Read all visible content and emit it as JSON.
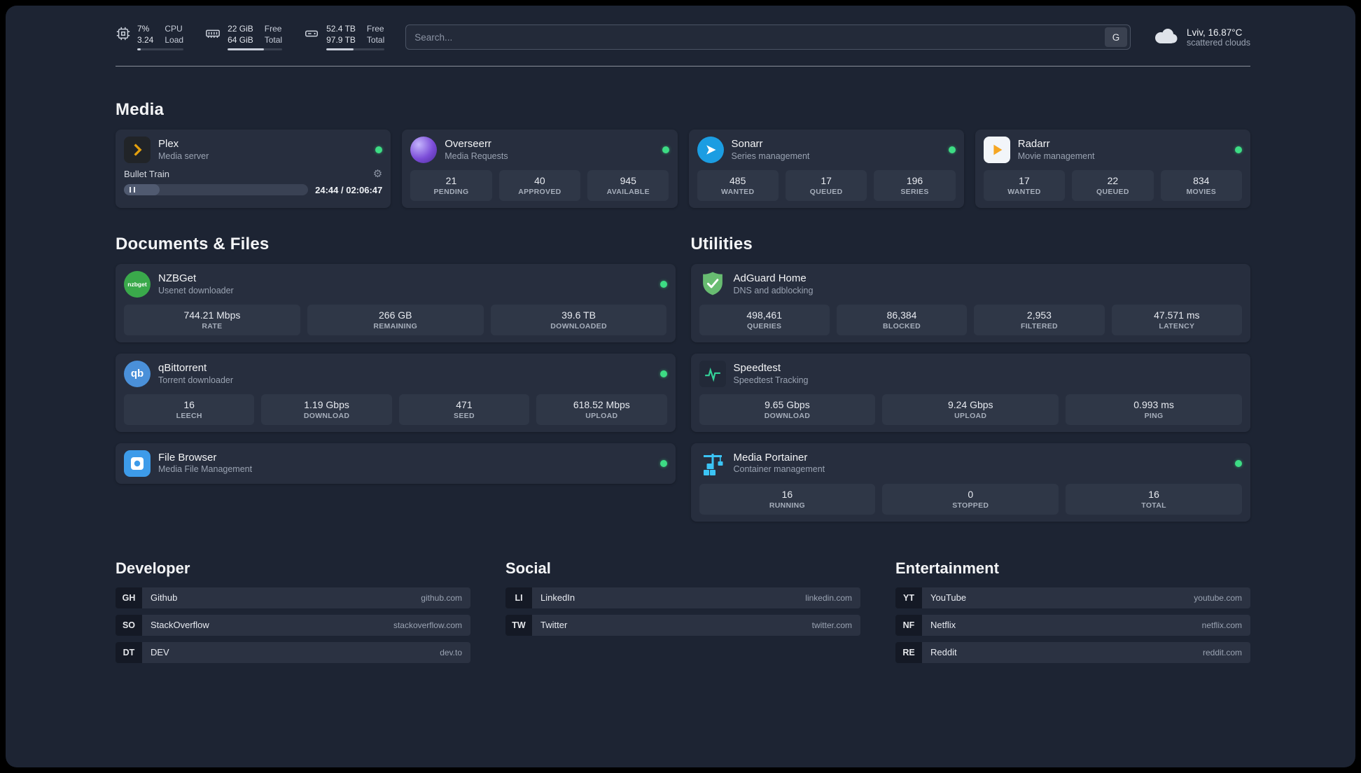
{
  "topbar": {
    "cpu": {
      "v1": "7%",
      "v2": "3.24",
      "l1": "CPU",
      "l2": "Load",
      "bar_pct": 7
    },
    "mem": {
      "v1": "22 GiB",
      "v2": "64 GiB",
      "l1": "Free",
      "l2": "Total",
      "bar_pct": 66
    },
    "disk": {
      "v1": "52.4 TB",
      "v2": "97.9 TB",
      "l1": "Free",
      "l2": "Total",
      "bar_pct": 47
    },
    "search": {
      "placeholder": "Search...",
      "button": "G"
    },
    "weather": {
      "location": "Lviv, 16.87°C",
      "condition": "scattered clouds"
    }
  },
  "sections": {
    "media": "Media",
    "documents": "Documents & Files",
    "utilities": "Utilities",
    "developer": "Developer",
    "social": "Social",
    "entertainment": "Entertainment"
  },
  "services": {
    "plex": {
      "name": "Plex",
      "desc": "Media server",
      "now_playing": "Bullet Train",
      "time": "24:44 / 02:06:47",
      "progress_pct": 19.5
    },
    "overseerr": {
      "name": "Overseerr",
      "desc": "Media Requests",
      "stats": [
        {
          "value": "21",
          "label": "PENDING"
        },
        {
          "value": "40",
          "label": "APPROVED"
        },
        {
          "value": "945",
          "label": "AVAILABLE"
        }
      ]
    },
    "sonarr": {
      "name": "Sonarr",
      "desc": "Series management",
      "stats": [
        {
          "value": "485",
          "label": "WANTED"
        },
        {
          "value": "17",
          "label": "QUEUED"
        },
        {
          "value": "196",
          "label": "SERIES"
        }
      ]
    },
    "radarr": {
      "name": "Radarr",
      "desc": "Movie management",
      "stats": [
        {
          "value": "17",
          "label": "WANTED"
        },
        {
          "value": "22",
          "label": "QUEUED"
        },
        {
          "value": "834",
          "label": "MOVIES"
        }
      ]
    },
    "nzbget": {
      "name": "NZBGet",
      "desc": "Usenet downloader",
      "icon_text": "nzbget",
      "stats": [
        {
          "value": "744.21 Mbps",
          "label": "RATE"
        },
        {
          "value": "266 GB",
          "label": "REMAINING"
        },
        {
          "value": "39.6 TB",
          "label": "DOWNLOADED"
        }
      ]
    },
    "qbittorrent": {
      "name": "qBittorrent",
      "desc": "Torrent downloader",
      "icon_text": "qb",
      "stats": [
        {
          "value": "16",
          "label": "LEECH"
        },
        {
          "value": "1.19 Gbps",
          "label": "DOWNLOAD"
        },
        {
          "value": "471",
          "label": "SEED"
        },
        {
          "value": "618.52 Mbps",
          "label": "UPLOAD"
        }
      ]
    },
    "filebrowser": {
      "name": "File Browser",
      "desc": "Media File Management"
    },
    "adguard": {
      "name": "AdGuard Home",
      "desc": "DNS and adblocking",
      "stats": [
        {
          "value": "498,461",
          "label": "QUERIES"
        },
        {
          "value": "86,384",
          "label": "BLOCKED"
        },
        {
          "value": "2,953",
          "label": "FILTERED"
        },
        {
          "value": "47.571 ms",
          "label": "LATENCY"
        }
      ]
    },
    "speedtest": {
      "name": "Speedtest",
      "desc": "Speedtest Tracking",
      "stats": [
        {
          "value": "9.65 Gbps",
          "label": "DOWNLOAD"
        },
        {
          "value": "9.24 Gbps",
          "label": "UPLOAD"
        },
        {
          "value": "0.993 ms",
          "label": "PING"
        }
      ]
    },
    "portainer": {
      "name": "Media Portainer",
      "desc": "Container management",
      "stats": [
        {
          "value": "16",
          "label": "RUNNING"
        },
        {
          "value": "0",
          "label": "STOPPED"
        },
        {
          "value": "16",
          "label": "TOTAL"
        }
      ]
    }
  },
  "bookmarks": {
    "developer": [
      {
        "abbr": "GH",
        "name": "Github",
        "domain": "github.com"
      },
      {
        "abbr": "SO",
        "name": "StackOverflow",
        "domain": "stackoverflow.com"
      },
      {
        "abbr": "DT",
        "name": "DEV",
        "domain": "dev.to"
      }
    ],
    "social": [
      {
        "abbr": "LI",
        "name": "LinkedIn",
        "domain": "linkedin.com"
      },
      {
        "abbr": "TW",
        "name": "Twitter",
        "domain": "twitter.com"
      }
    ],
    "entertainment": [
      {
        "abbr": "YT",
        "name": "YouTube",
        "domain": "youtube.com"
      },
      {
        "abbr": "NF",
        "name": "Netflix",
        "domain": "netflix.com"
      },
      {
        "abbr": "RE",
        "name": "Reddit",
        "domain": "reddit.com"
      }
    ]
  },
  "icons": {
    "gear": "⚙"
  }
}
